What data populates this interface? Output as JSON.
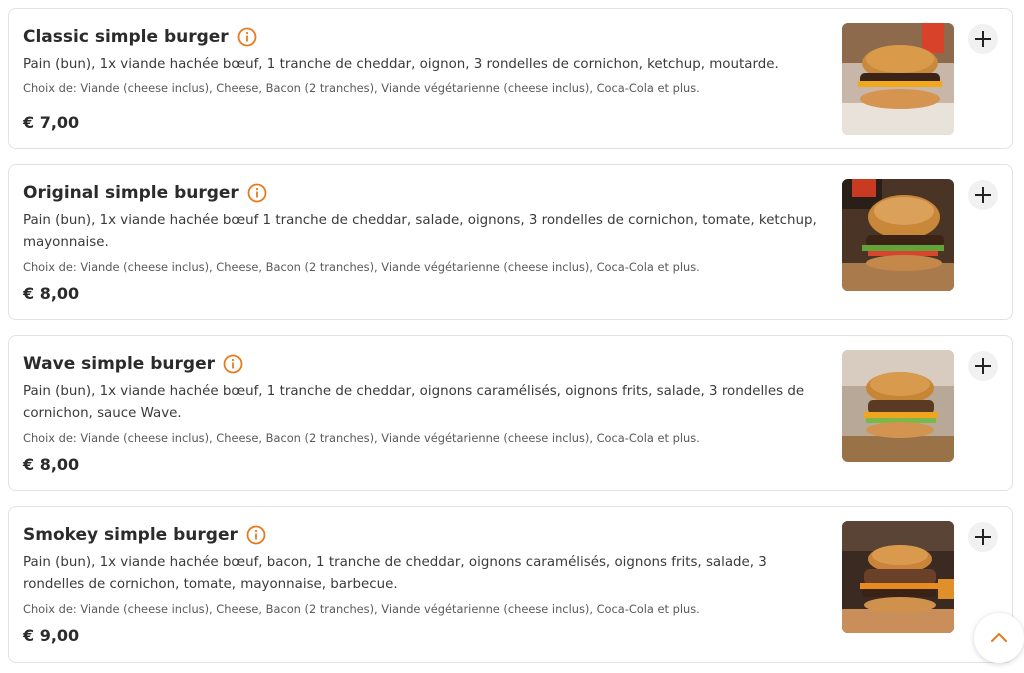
{
  "accent_color": "#e87a1e",
  "items": [
    {
      "title": "Classic simple burger",
      "description": "Pain (bun), 1x viande hachée bœuf, 1 tranche de cheddar, oignon, 3 rondelles de cornichon, ketchup, moutarde.",
      "choices": "Choix de: Viande (cheese inclus), Cheese, Bacon (2 tranches), Viande végétarienne (cheese inclus), Coca-Cola et plus.",
      "price": "€ 7,00",
      "icons": {
        "info": "info-icon",
        "add": "plus-icon"
      }
    },
    {
      "title": "Original simple burger",
      "description": "Pain (bun), 1x viande hachée bœuf 1 tranche de cheddar, salade, oignons, 3 rondelles de cornichon, tomate, ketchup, mayonnaise.",
      "choices": "Choix de: Viande (cheese inclus), Cheese, Bacon (2 tranches), Viande végétarienne (cheese inclus), Coca-Cola et plus.",
      "price": "€ 8,00",
      "icons": {
        "info": "info-icon",
        "add": "plus-icon"
      }
    },
    {
      "title": "Wave simple burger",
      "description": "Pain (bun), 1x viande hachée bœuf, 1 tranche de cheddar, oignons caramélisés, oignons frits, salade, 3 rondelles de cornichon, sauce Wave.",
      "choices": "Choix de: Viande (cheese inclus), Cheese, Bacon (2 tranches), Viande végétarienne (cheese inclus), Coca-Cola et plus.",
      "price": "€ 8,00",
      "icons": {
        "info": "info-icon",
        "add": "plus-icon"
      }
    },
    {
      "title": "Smokey simple burger",
      "description": "Pain (bun), 1x viande hachée bœuf, bacon, 1 tranche de cheddar, oignons caramélisés, oignons frits, salade, 3 rondelles de cornichon, tomate, mayonnaise, barbecue.",
      "choices": "Choix de: Viande (cheese inclus), Cheese, Bacon (2 tranches), Viande végétarienne (cheese inclus), Coca-Cola et plus.",
      "price": "€ 9,00",
      "icons": {
        "info": "info-icon",
        "add": "plus-icon"
      }
    }
  ],
  "scroll_top_icon": "chevron-up-icon"
}
